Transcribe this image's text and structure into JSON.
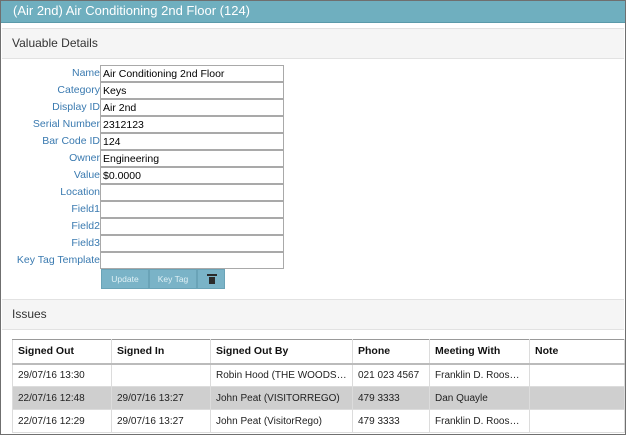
{
  "window": {
    "title": "(Air 2nd) Air Conditioning 2nd Floor (124)"
  },
  "details": {
    "heading": "Valuable Details",
    "fields": [
      {
        "label": "Name",
        "value": "Air Conditioning 2nd Floor"
      },
      {
        "label": "Category",
        "value": "Keys"
      },
      {
        "label": "Display ID",
        "value": "Air 2nd"
      },
      {
        "label": "Serial Number",
        "value": "2312123"
      },
      {
        "label": "Bar Code ID",
        "value": "124"
      },
      {
        "label": "Owner",
        "value": "Engineering"
      },
      {
        "label": "Value",
        "value": "$0.0000"
      },
      {
        "label": "Location",
        "value": ""
      },
      {
        "label": "Field1",
        "value": ""
      },
      {
        "label": "Field2",
        "value": ""
      },
      {
        "label": "Field3",
        "value": ""
      },
      {
        "label": "Key Tag Template",
        "value": ""
      }
    ],
    "buttons": {
      "update": "Update",
      "key_tag": "Key Tag",
      "delete_icon": "trash-icon"
    }
  },
  "issues": {
    "heading": "Issues",
    "columns": [
      "Signed Out",
      "Signed In",
      "Signed Out By",
      "Phone",
      "Meeting With",
      "Note"
    ],
    "rows": [
      [
        "29/07/16 13:30",
        "",
        "Robin Hood (THE WOODS IN...",
        "021 023 4567",
        "Franklin D. Roosev...",
        ""
      ],
      [
        "22/07/16 12:48",
        "29/07/16 13:27",
        "John Peat (VISITORREGO)",
        "479 3333",
        "Dan Quayle",
        ""
      ],
      [
        "22/07/16 12:29",
        "29/07/16 13:27",
        "John Peat (VisitorRego)",
        "479 3333",
        "Franklin D. Roosev...",
        ""
      ]
    ]
  },
  "colors": {
    "titlebar": "#6fafbf",
    "label": "#3a7ab0",
    "button": "#7ab3c7",
    "row_highlight": "#cfcfcf"
  }
}
